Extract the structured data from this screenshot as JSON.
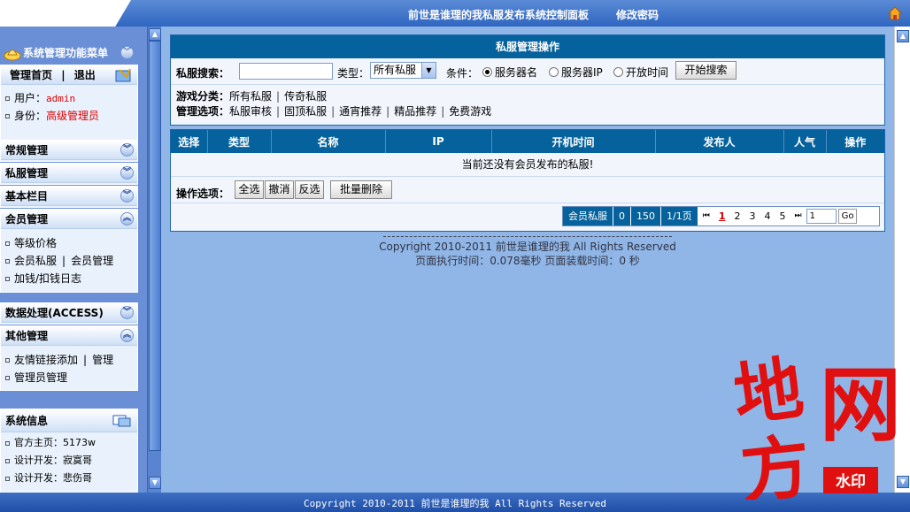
{
  "top": {
    "title": "前世是谁理的我私服发布系统控制面板",
    "change_password": "修改密码",
    "home_icon": "home-icon"
  },
  "sidebar": {
    "menu_title": "系统管理功能菜单",
    "admin": {
      "home": "管理首页",
      "sep": "|",
      "logout": "退出",
      "user_label": "用户：",
      "user_value": "admin",
      "role_label": "身份：",
      "role_value": "高级管理员"
    },
    "sections": {
      "regular": "常规管理",
      "private": "私服管理",
      "basic": "基本栏目",
      "member": "会员管理",
      "data": "数据处理(ACCESS)",
      "other": "其他管理",
      "sysinfo": "系统信息"
    },
    "member_items": {
      "level": "等级价格",
      "member_private": "会员私服",
      "sep": "|",
      "member_manage": "会员管理",
      "money_log": "加钱/扣钱日志"
    },
    "other_items": {
      "link_add": "友情链接添加",
      "sep": "|",
      "link_manage": "管理",
      "admin_manage": "管理员管理"
    },
    "sysinfo_items": {
      "homepage": "官方主页：5173w",
      "dev1": "设计开发：寂寞哥",
      "dev2": "设计开发：悲伤哥"
    }
  },
  "panel": {
    "title": "私服管理操作",
    "search_label": "私服搜索：",
    "search_value": "",
    "type_label": "类型：",
    "type_selected": "所有私服",
    "condition_label": "条件：",
    "conditions": [
      "服务器名",
      "服务器IP",
      "开放时间"
    ],
    "condition_selected": 0,
    "search_button": "开始搜索",
    "category_label": "游戏分类：",
    "categories": [
      "所有私服",
      "传奇私服"
    ],
    "sep": "|",
    "options_label": "管理选项：",
    "options": [
      "私服审核",
      "固顶私服",
      "通宵推荐",
      "精品推荐",
      "免费游戏"
    ]
  },
  "table": {
    "columns": [
      "选择",
      "类型",
      "名称",
      "IP",
      "开机时间",
      "发布人",
      "人气",
      "操作"
    ],
    "empty_message": "当前还没有会员发布的私服!",
    "ops_label": "操作选项：",
    "select_all": "全选",
    "cancel": "撤消",
    "invert": "反选",
    "batch_delete": "批量删除"
  },
  "pager": {
    "label": "会员私服",
    "count": "0",
    "per_page": "150",
    "page_info": "1/1页",
    "first": "⏮",
    "pages": [
      "1",
      "2",
      "3",
      "4",
      "5"
    ],
    "current": "1",
    "last": "⏭",
    "jump_value": "1",
    "go": "Go"
  },
  "footer": {
    "copyright": "Copyright 2010-2011 前世是谁理的我  All Rights Reserved",
    "timing": "页面执行时间：0.078毫秒   页面装载时间：0 秒"
  },
  "bottom": {
    "copyright": "Copyright 2010-2011 前世是谁理的我 All Rights Reserved"
  },
  "watermark": {
    "chars": [
      "地",
      "方",
      "网"
    ],
    "badge": "水印"
  },
  "colors": {
    "header_blue": "#06629c",
    "sidebar_blue": "#6a8fd6",
    "main_bg": "#8fb6e6",
    "watermark_red": "#e01010"
  }
}
